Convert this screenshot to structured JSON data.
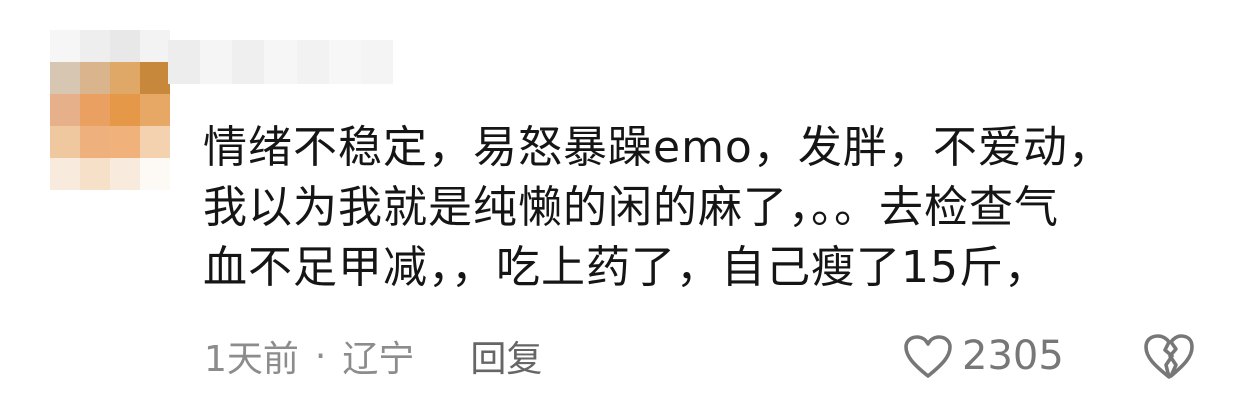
{
  "avatar": {
    "blocked": true,
    "pixel_colors": [
      [
        "#f6f6f6",
        "#eeeeee",
        "#e8e8e8",
        "#f3f3f3"
      ],
      [
        "#d7c6b2",
        "#d9b48c",
        "#e0a866",
        "#c8883c"
      ],
      [
        "#e6b08a",
        "#eaa060",
        "#e49848",
        "#e6a864"
      ],
      [
        "#f0c8a0",
        "#eeb07c",
        "#f0b27a",
        "#f4d2b0"
      ],
      [
        "#f8ebde",
        "#f6e0c8",
        "#f8eadc",
        "#fdfaf6"
      ]
    ]
  },
  "username": {
    "blurred": true,
    "pixel_colors": [
      "#ededed",
      "#f5f5f5",
      "#efefef",
      "#f6f6f6",
      "#f2f2f2",
      "#f7f7f7",
      "#f4f4f4"
    ]
  },
  "comment": {
    "text": "情绪不稳定，易怒暴躁emo，发胖，不爱动，\n我以为我就是纯懒的闲的麻了，。。去检查气\n血不足甲减，，吃上药了，自己瘦了15斤，"
  },
  "meta": {
    "time": "1天前",
    "separator": "·",
    "location": "辽宁",
    "reply_label": "回复"
  },
  "actions": {
    "like_count": "2305",
    "like_icon": "heart-outline-icon",
    "dislike_icon": "broken-heart-icon",
    "icon_color": "#777777"
  }
}
